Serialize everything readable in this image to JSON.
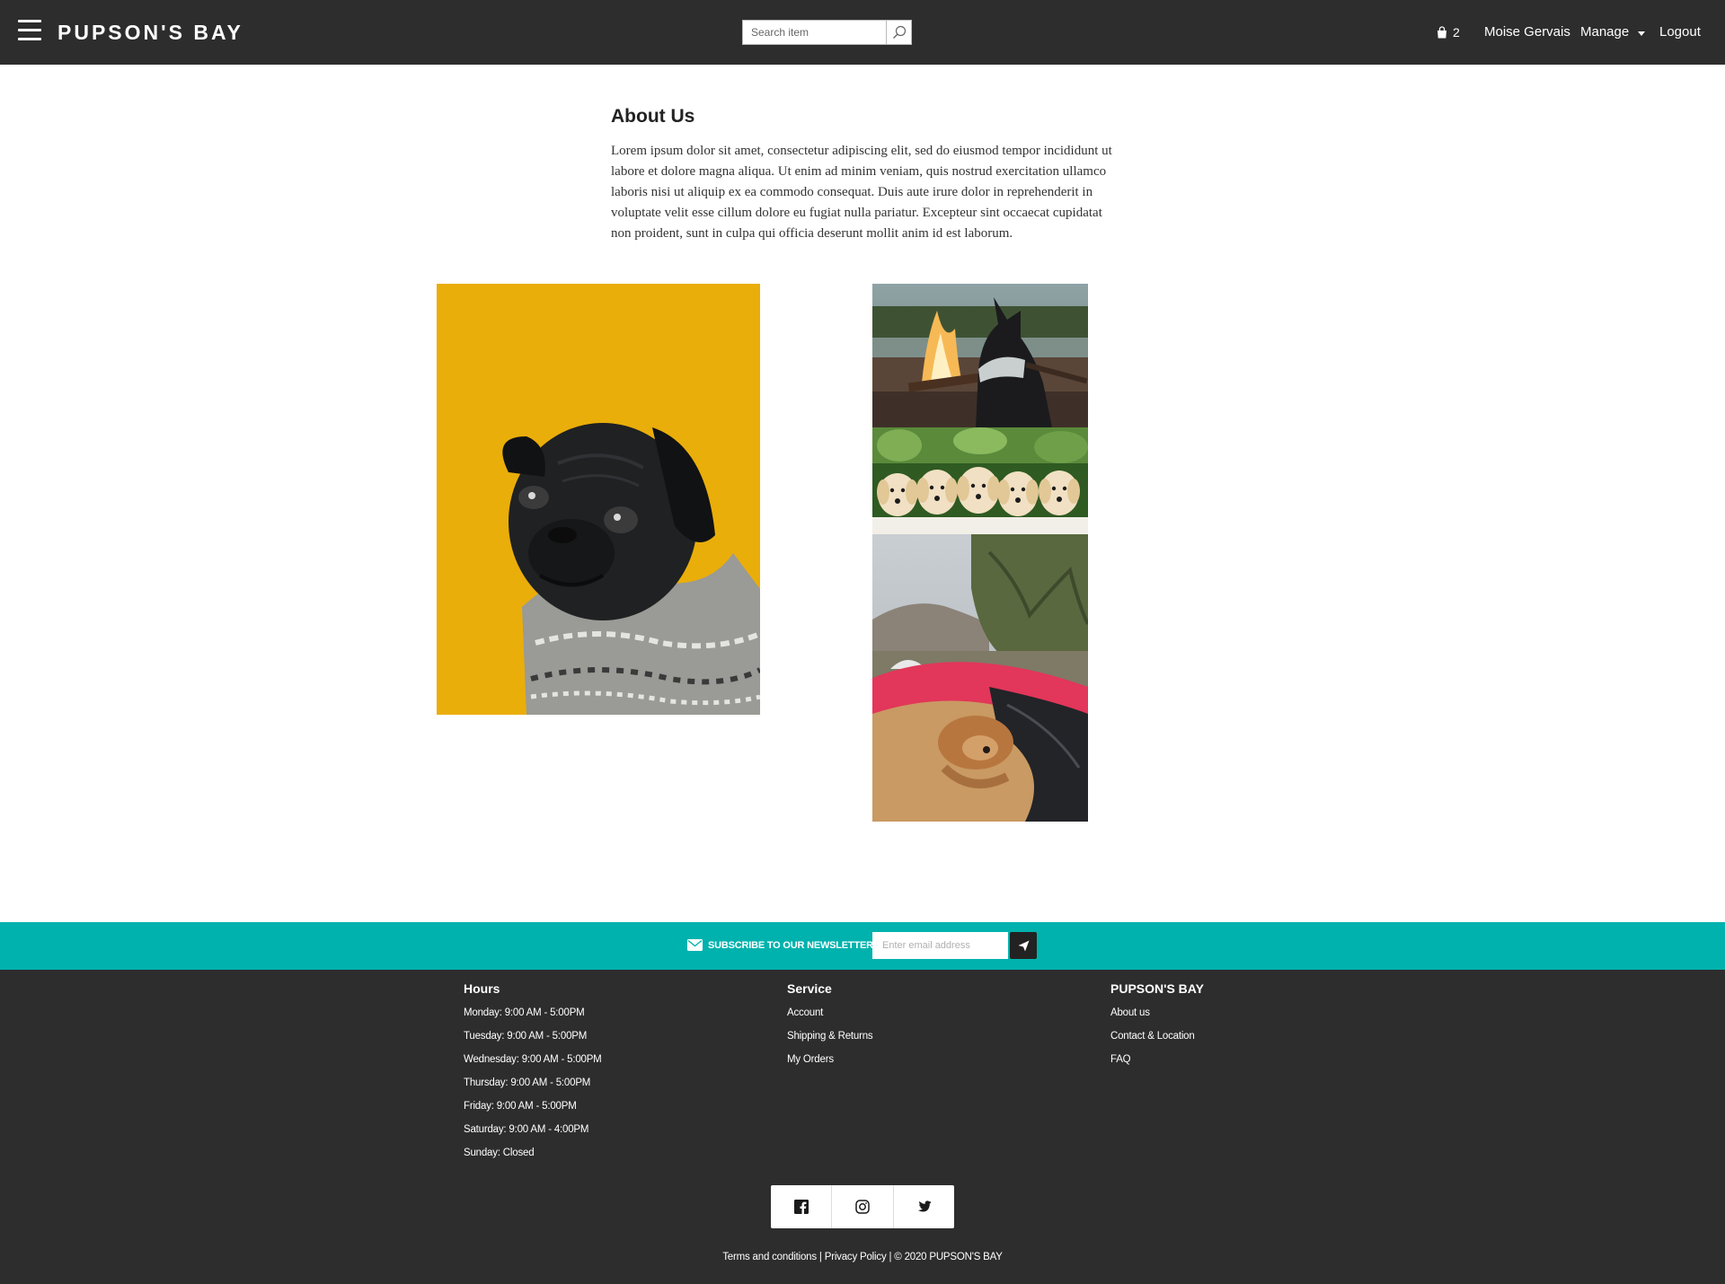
{
  "header": {
    "brand": "PUPSON'S BAY",
    "search_placeholder": "Search item",
    "cart_count": "2",
    "user_name": "Moise Gervais",
    "manage_label": "Manage",
    "logout_label": "Logout",
    "icons": [
      "menu-icon",
      "search-icon",
      "shopping-bag-icon",
      "caret-down-icon"
    ]
  },
  "about": {
    "title": "About Us",
    "body": "Lorem ipsum dolor sit amet, consectetur adipiscing elit, sed do eiusmod tempor incididunt ut labore et dolore magna aliqua. Ut enim ad minim veniam, quis nostrud exercitation ullamco laboris nisi ut aliquip ex ea commodo consequat. Duis aute irure dolor in reprehenderit in voluptate velit esse cillum dolore eu fugiat nulla pariatur. Excepteur sint occaecat cupidatat non proident, sunt in culpa qui officia deserunt mollit anim id est laborum."
  },
  "newsletter": {
    "label": "SUBSCRIBE TO OUR NEWSLETTER",
    "placeholder": "Enter email address",
    "icons": [
      "envelope-icon",
      "send-icon"
    ]
  },
  "footer": {
    "hours": {
      "title": "Hours",
      "items": [
        "Monday: 9:00 AM - 5:00PM",
        "Tuesday: 9:00 AM - 5:00PM",
        "Wednesday: 9:00 AM - 5:00PM",
        "Thursday: 9:00 AM - 5:00PM",
        "Friday: 9:00 AM - 5:00PM",
        "Saturday: 9:00 AM - 4:00PM",
        "Sunday: Closed"
      ]
    },
    "service": {
      "title": "Service",
      "items": [
        "Account",
        "Shipping & Returns",
        "My Orders"
      ]
    },
    "brand": {
      "title": "PUPSON'S BAY",
      "items": [
        "About us",
        "Contact & Location",
        "FAQ"
      ]
    },
    "social_icons": [
      "facebook-icon",
      "instagram-icon",
      "twitter-icon"
    ],
    "terms": "Terms and conditions",
    "privacy": "Privacy Policy",
    "sep": "|",
    "copyright": "© 2020 PUPSON'S BAY"
  },
  "colors": {
    "header_bg": "#2d2d2d",
    "newsletter_bg": "#00b2ad",
    "footer_bg": "#2d2d2d",
    "pug_photo_bg": "#ecb00a"
  }
}
